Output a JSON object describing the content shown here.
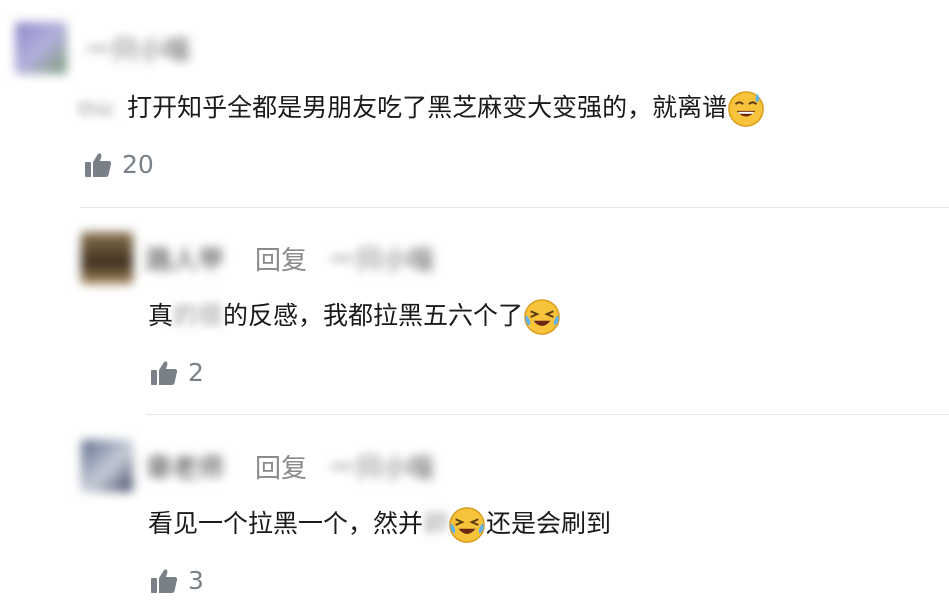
{
  "comment": {
    "name": "一只小喵",
    "content_prefix": "",
    "content_blur": "thic",
    "content_main": "打开知乎全都是男朋友吃了黑芝麻变大变强的，就离谱",
    "emoji": "sweat-smile-emoji",
    "likes": "20"
  },
  "replies": [
    {
      "name": "路人甲",
      "reply_label": "回复",
      "reply_to": "一只小喵",
      "content_a": "真",
      "content_blur": "的很",
      "content_b": "的反感，我都拉黑五六个了",
      "emoji": "laughing-crying-emoji",
      "likes": "2"
    },
    {
      "name": "章老师",
      "reply_label": "回复",
      "reply_to": "一只小喵",
      "content_a": "看见一个拉黑一个，然并",
      "content_blur": "卵",
      "content_b": "还是会刷到",
      "emoji": "laughing-crying-emoji",
      "likes": "3"
    }
  ],
  "colors": {
    "text": "#1a1a1a",
    "secondary": "#8a8a8a",
    "like_icon": "#7a8088",
    "divider": "#e7e7e7"
  }
}
